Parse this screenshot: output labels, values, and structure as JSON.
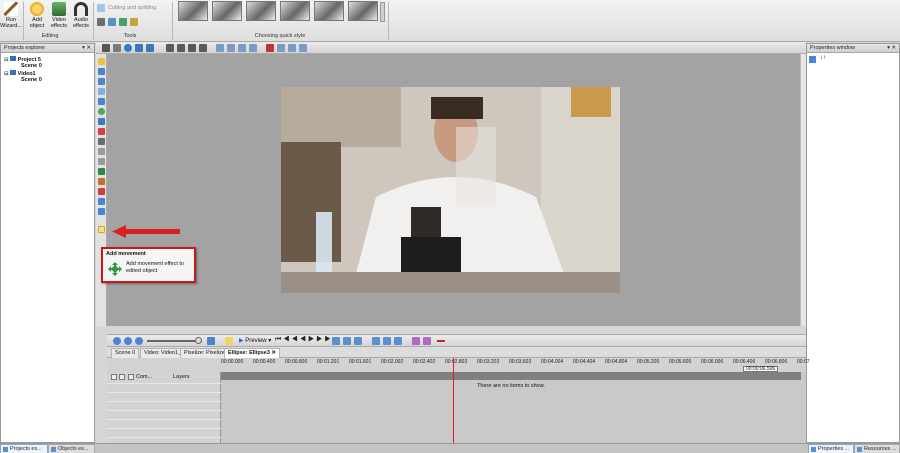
{
  "ribbon": {
    "run_wizard": "Run\nWizard...",
    "add_object": "Add\nobject",
    "video_effects": "Video\neffects",
    "audio_effects": "Audio\neffects",
    "editing_group": "Editing",
    "cutting_splitting": "Cutting and splitting",
    "tools_group": "Tools",
    "quick_style_group": "Choosing quick style"
  },
  "projects_explorer": {
    "title": "Projects explorer",
    "items": [
      {
        "label": "Project 5"
      },
      {
        "label": "Scene 0"
      },
      {
        "label": "Video1"
      },
      {
        "label": "Scene 0"
      }
    ]
  },
  "properties_window": {
    "title": "Properties window"
  },
  "tooltip": {
    "title": "Add movement",
    "description": "Add movement effect to edited object"
  },
  "timeline": {
    "preview_label": "Preview",
    "tabs": [
      "Scene 0",
      "Video: Video1_1",
      "Pixelize: Pixelize1",
      "Ellipse: Ellipse3"
    ],
    "ruler_ticks": [
      "00:00.000",
      "00:00.400",
      "00:00.800",
      "00:01.201",
      "00:01.601",
      "00:02.002",
      "00:02.402",
      "00:02.803",
      "00:03.203",
      "00:03.603",
      "00:04.004",
      "00:04.404",
      "00:04.804",
      "00:05.205",
      "00:05.605",
      "00:06.006",
      "00:06.406",
      "00:06.806",
      "00:07"
    ],
    "current_time": "00:00:06.506",
    "layer_col_com": "Com...",
    "layer_col_layers": "Layers",
    "empty_message": "There are no items to show."
  },
  "bottom_tabs": {
    "projects": "Projects ex...",
    "objects": "Objects ex...",
    "properties": "Properties ...",
    "resources": "Resources ..."
  },
  "colors": {
    "accent_red": "#c8191a",
    "arrow_red": "#d9201e",
    "playhead": "#e02020"
  }
}
